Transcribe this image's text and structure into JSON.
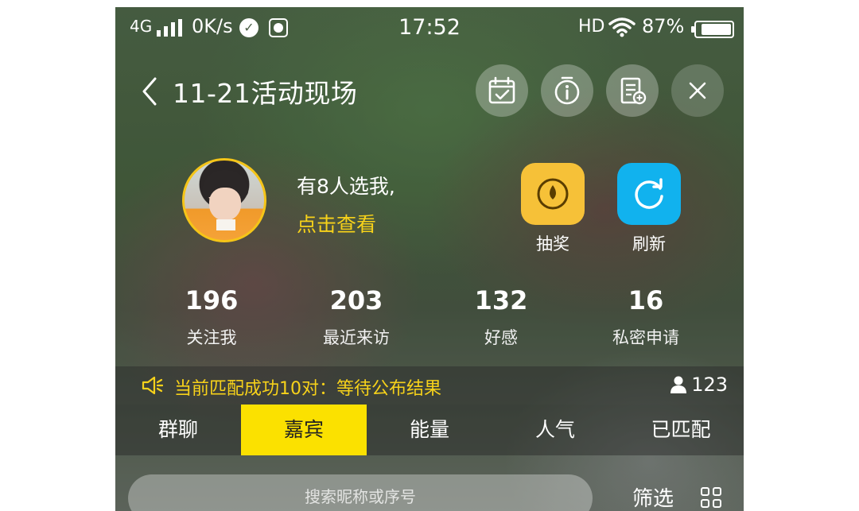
{
  "status_bar": {
    "network": "4G",
    "speed": "0K/s",
    "time": "17:52",
    "hd": "HD",
    "battery_percent": "87%",
    "battery_level": 0.87
  },
  "header": {
    "title": "11-21活动现场",
    "icons": [
      "calendar-check-icon",
      "info-icon",
      "note-add-icon",
      "close-icon"
    ]
  },
  "profile": {
    "line1": "有8人选我,",
    "line2": "点击查看",
    "actions": [
      {
        "label": "抽奖",
        "icon": "lottery-icon",
        "color": "#f6c138"
      },
      {
        "label": "刷新",
        "icon": "refresh-icon",
        "color": "#11b2ee"
      }
    ]
  },
  "stats": [
    {
      "value": "196",
      "label": "关注我"
    },
    {
      "value": "203",
      "label": "最近来访"
    },
    {
      "value": "132",
      "label": "好感"
    },
    {
      "value": "16",
      "label": "私密申请"
    }
  ],
  "notice": {
    "text": "当前匹配成功10对：等待公布结果",
    "user_count": "123"
  },
  "tabs": [
    {
      "label": "群聊",
      "active": false
    },
    {
      "label": "嘉宾",
      "active": true
    },
    {
      "label": "能量",
      "active": false
    },
    {
      "label": "人气",
      "active": false
    },
    {
      "label": "已匹配",
      "active": false
    }
  ],
  "search": {
    "placeholder": "搜索昵称或序号",
    "filter_label": "筛选"
  },
  "colors": {
    "accent_yellow": "#fbe100",
    "highlight_text": "#f7d21a",
    "lottery_bg": "#f6c138",
    "refresh_bg": "#11b2ee"
  }
}
